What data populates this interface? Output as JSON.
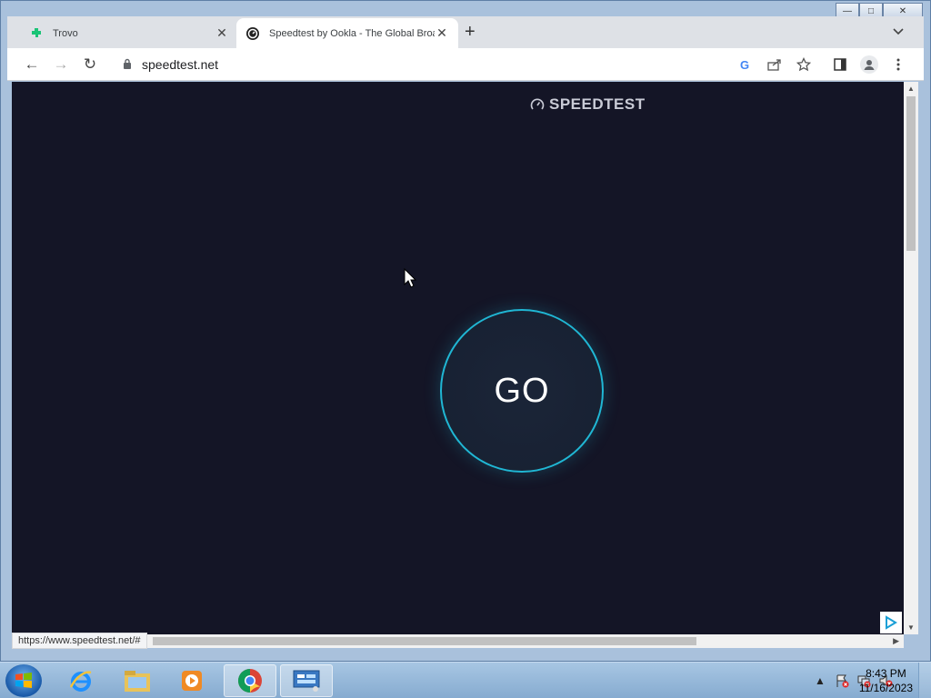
{
  "window": {
    "caption": {
      "minimize": "—",
      "maximize": "□",
      "close": "✕"
    }
  },
  "tabs": [
    {
      "title": "Trovo",
      "favicon": "trovo-icon",
      "active": false
    },
    {
      "title": "Speedtest by Ookla - The Global Broadband Speed Test",
      "favicon": "speedtest-icon",
      "active": true
    }
  ],
  "toolbar": {
    "back": "←",
    "forward": "→",
    "reload": "↻",
    "url": "speedtest.net",
    "new_tab": "+",
    "tab_search": "⌄",
    "icons": [
      "google-lens-icon",
      "share-icon",
      "bookmark-star-icon",
      "side-panel-icon",
      "profile-icon",
      "menu-icon"
    ]
  },
  "page": {
    "logo_text": "SPEEDTEST",
    "go_label": "GO",
    "status_url": "https://www.speedtest.net/#"
  },
  "taskbar": {
    "pinned": [
      "internet-explorer-icon",
      "file-explorer-icon",
      "media-player-icon",
      "chrome-icon",
      "control-panel-icon"
    ],
    "time": "8:43 PM",
    "date": "11/16/2023"
  },
  "colors": {
    "page_bg": "#141526",
    "go_ring": "#20b7d4",
    "logo_text": "#c9cbd6"
  }
}
